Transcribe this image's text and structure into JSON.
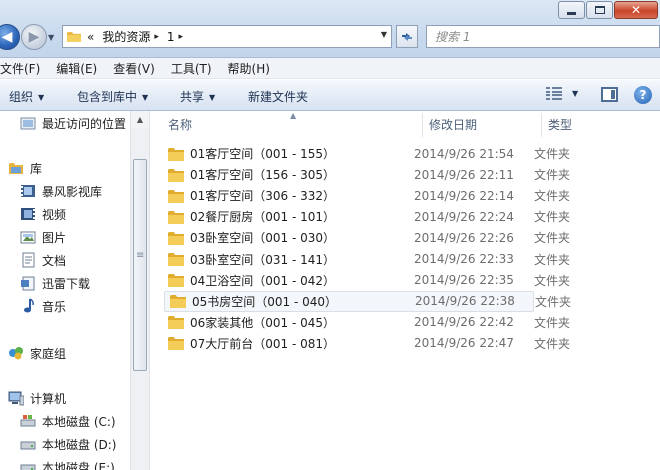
{
  "window": {
    "minimize_icon": "minimize-icon",
    "maximize_icon": "maximize-icon",
    "close_icon": "close-icon"
  },
  "navigation": {
    "back_icon": "back-arrow-icon",
    "forward_icon": "forward-arrow-icon",
    "history_icon": "chevron-down-icon"
  },
  "address": {
    "overflow": "«",
    "crumbs": [
      "我的资源",
      "1"
    ],
    "sep": "▸",
    "dropdown_icon": "chevron-down-icon",
    "refresh_icon": "refresh-icon"
  },
  "search": {
    "placeholder": "搜索 1"
  },
  "menu": [
    "文件(F)",
    "编辑(E)",
    "查看(V)",
    "工具(T)",
    "帮助(H)"
  ],
  "commands": {
    "organize": "组织",
    "include_library": "包含到库中",
    "share": "共享",
    "new_folder": "新建文件夹",
    "help_glyph": "?"
  },
  "sidebar": {
    "recent": "最近访问的位置",
    "libraries": "库",
    "library_items": [
      "暴风影视库",
      "视频",
      "图片",
      "文档",
      "迅雷下载",
      "音乐"
    ],
    "homegroup": "家庭组",
    "computer": "计算机",
    "drives": [
      "本地磁盘 (C:)",
      "本地磁盘 (D:)",
      "本地磁盘 (E:)"
    ]
  },
  "columns": {
    "name": "名称",
    "date": "修改日期",
    "type": "类型"
  },
  "files": [
    {
      "name": "01客厅空间（001 - 155）",
      "date": "2014/9/26 21:54",
      "type": "文件夹"
    },
    {
      "name": "01客厅空间（156 - 305）",
      "date": "2014/9/26 22:11",
      "type": "文件夹"
    },
    {
      "name": "01客厅空间（306 - 332）",
      "date": "2014/9/26 22:14",
      "type": "文件夹"
    },
    {
      "name": "02餐厅厨房（001 - 101）",
      "date": "2014/9/26 22:24",
      "type": "文件夹"
    },
    {
      "name": "03卧室空间（001 - 030）",
      "date": "2014/9/26 22:26",
      "type": "文件夹"
    },
    {
      "name": "03卧室空间（031 - 141）",
      "date": "2014/9/26 22:33",
      "type": "文件夹"
    },
    {
      "name": "04卫浴空间（001 - 042）",
      "date": "2014/9/26 22:35",
      "type": "文件夹"
    },
    {
      "name": "05书房空间（001 - 040）",
      "date": "2014/9/26 22:38",
      "type": "文件夹"
    },
    {
      "name": "06家装其他（001 - 045）",
      "date": "2014/9/26 22:42",
      "type": "文件夹"
    },
    {
      "name": "07大厅前台（001 - 081）",
      "date": "2014/9/26 22:47",
      "type": "文件夹"
    }
  ],
  "selected_index": 7,
  "colors": {
    "accent": "#2a63b8",
    "folder": "#f2c44b",
    "selection": "#f3f6fa",
    "close": "#c8452a"
  }
}
